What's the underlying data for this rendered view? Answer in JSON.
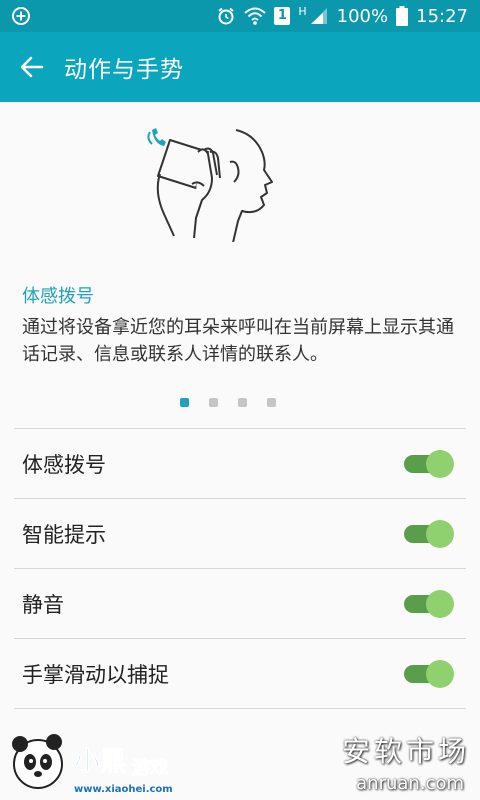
{
  "status_bar": {
    "battery": "100%",
    "time": "15:27",
    "network_type": "H",
    "sim": "1"
  },
  "app_bar": {
    "title": "动作与手势"
  },
  "feature": {
    "title": "体感拨号",
    "description": "通过将设备拿近您的耳朵来呼叫在当前屏幕上显示其通话记录、信息或联系人详情的联系人。"
  },
  "pager": {
    "count": 4,
    "active": 1
  },
  "settings": [
    {
      "label": "体感拨号",
      "enabled": true
    },
    {
      "label": "智能提示",
      "enabled": true
    },
    {
      "label": "静音",
      "enabled": true
    },
    {
      "label": "手掌滑动以捕捉",
      "enabled": true
    }
  ],
  "watermark": {
    "site_name": "安软市场",
    "site_url": "anruan.com",
    "logo_text": "小黑游戏",
    "logo_url": "www.xiaohei.com"
  },
  "colors": {
    "accent": "#0ba5bd",
    "toggle_on": "#8fd16f"
  }
}
